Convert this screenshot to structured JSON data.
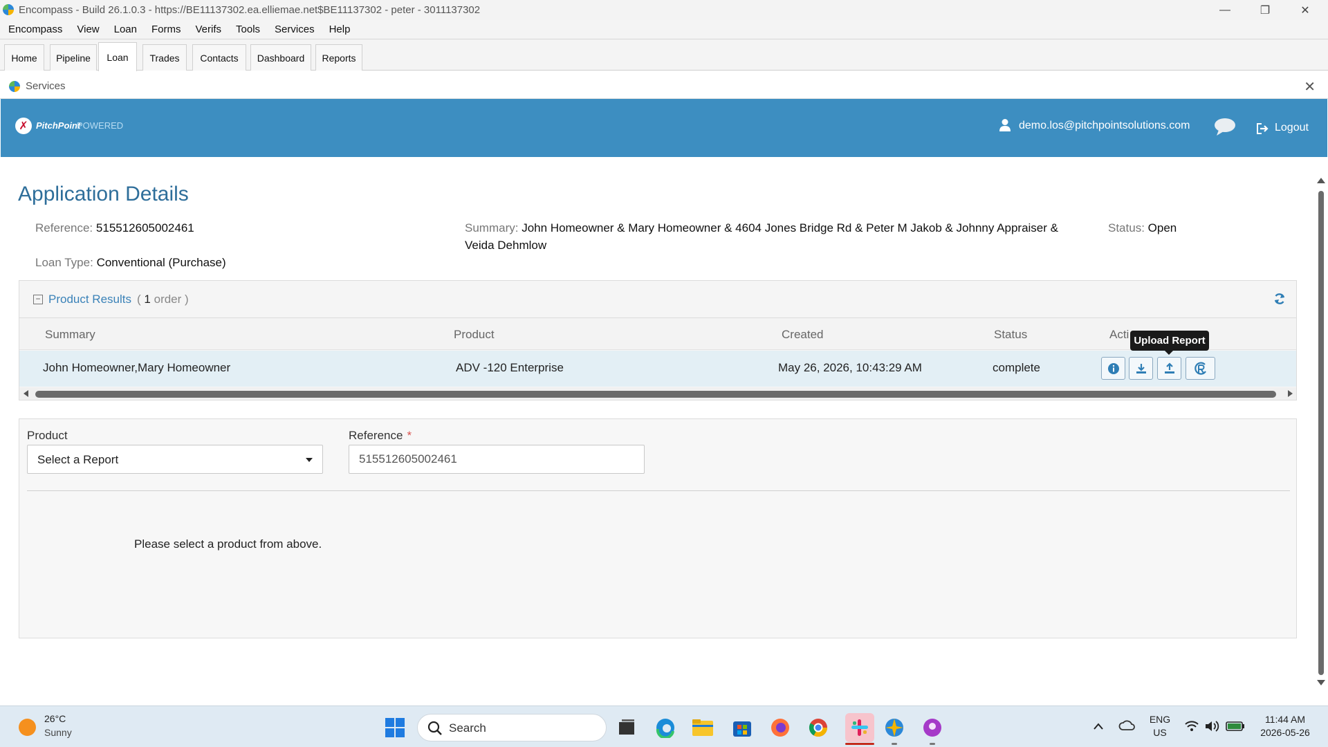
{
  "window": {
    "title": "Encompass - Build 26.1.0.3 - https://BE11137302.ea.elliemae.net$BE11137302 - peter - 3011137302",
    "minimize_glyph": "—",
    "restore_glyph": "❐",
    "close_glyph": "✕"
  },
  "menubar": {
    "items": [
      "Encompass",
      "View",
      "Loan",
      "Forms",
      "Verifs",
      "Tools",
      "Services",
      "Help"
    ]
  },
  "tabs": {
    "items": [
      "Home",
      "Pipeline",
      "Loan",
      "Trades",
      "Contacts",
      "Dashboard",
      "Reports"
    ],
    "active": "Loan"
  },
  "services_panel": {
    "title": "Services",
    "close_glyph": "✕"
  },
  "header": {
    "logo_mark": "✗",
    "logo_text": "PitchPoint",
    "logo_powered": "POWERED",
    "user_email": "demo.los@pitchpointsolutions.com",
    "logout_label": "Logout",
    "accent_color": "#3d8ec1"
  },
  "application": {
    "title": "Application Details",
    "reference_label": "Reference:",
    "reference_value": "515512605002461",
    "summary_label": "Summary:",
    "summary_line1": "John Homeowner & Mary Homeowner & 4604 Jones Bridge Rd & Peter M Jakob & Johnny Appraiser &",
    "summary_line2": "Veida Dehmlow",
    "status_label": "Status:",
    "status_value": "Open",
    "loan_type_label": "Loan Type:",
    "loan_type_value": "Conventional (Purchase)"
  },
  "product_results": {
    "title": "Product Results",
    "count_open": "(",
    "count": "1",
    "count_suffix": "order )",
    "columns": [
      "Summary",
      "Product",
      "Created",
      "Status",
      "Acti"
    ],
    "rows": [
      {
        "summary": "John Homeowner,Mary Homeowner",
        "product": "ADV -120 Enterprise",
        "created": "May 26, 2026, 10:43:29 AM",
        "status": "complete"
      }
    ],
    "tooltip": "Upload Report"
  },
  "order_form": {
    "product_label": "Product",
    "product_selected": "Select a Report",
    "reference_label": "Reference",
    "required_mark": "*",
    "reference_value": "515512605002461",
    "message": "Please select a product from above."
  },
  "taskbar": {
    "weather_temp": "26°C",
    "weather_desc": "Sunny",
    "search_label": "Search",
    "lang_line1": "ENG",
    "lang_line2": "US",
    "time": "11:44 AM",
    "date": "2026-05-26"
  }
}
